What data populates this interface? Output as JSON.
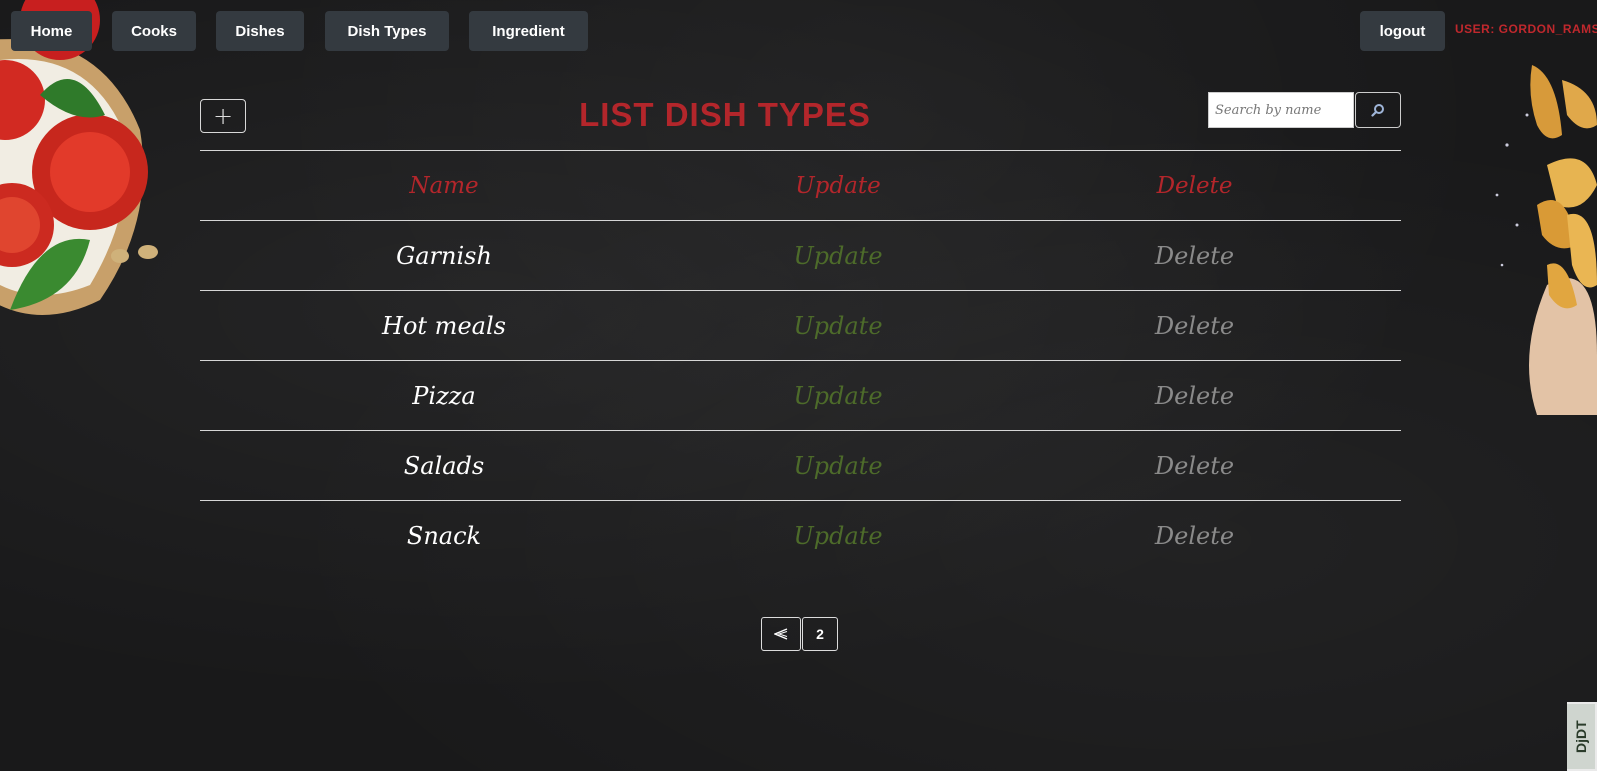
{
  "nav": {
    "home": "Home",
    "cooks": "Cooks",
    "dishes": "Dishes",
    "dish_types": "Dish Types",
    "ingredient": "Ingredient",
    "logout": "logout",
    "user": "USER: GORDON_RAMSAY"
  },
  "toolbar": {
    "add_label": "+",
    "title": "LIST DISH TYPES",
    "search_placeholder": "Search by name",
    "search_icon": "search-icon"
  },
  "table": {
    "headers": [
      "Name",
      "Update",
      "Delete"
    ],
    "rows": [
      {
        "name": "Garnish",
        "update": "Update",
        "delete": "Delete"
      },
      {
        "name": "Hot meals",
        "update": "Update",
        "delete": "Delete"
      },
      {
        "name": "Pizza",
        "update": "Update",
        "delete": "Delete"
      },
      {
        "name": "Salads",
        "update": "Update",
        "delete": "Delete"
      },
      {
        "name": "Snack",
        "update": "Update",
        "delete": "Delete"
      }
    ]
  },
  "pagination": {
    "prev_icon": "prev-page-icon",
    "page": "2"
  },
  "debug_toolbar": {
    "label": "DjDT"
  },
  "colors": {
    "accent_red": "#b3262b",
    "update_green": "#4d6b2a",
    "delete_gray": "#8a8a8a",
    "nav_button": "#343a40"
  }
}
